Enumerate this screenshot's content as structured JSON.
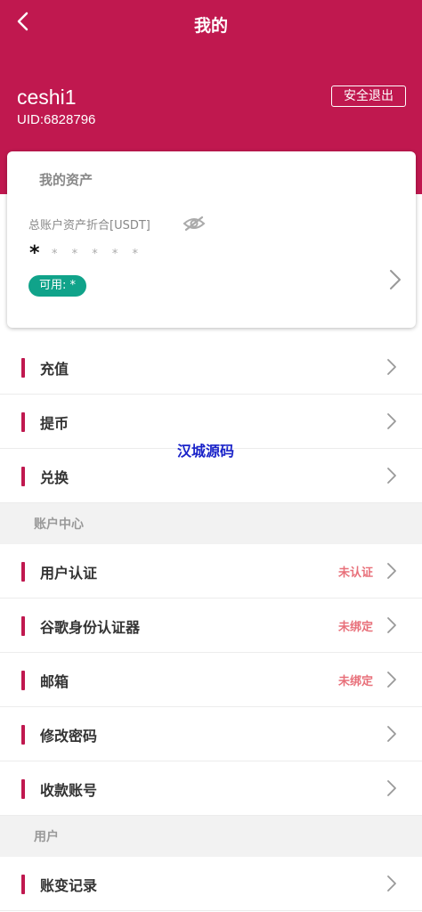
{
  "header": {
    "title": "我的",
    "username": "ceshi1",
    "uid": "UID:6828796",
    "logout_label": "安全退出",
    "accent_color": "#c0184f"
  },
  "assets": {
    "title": "我的资产",
    "total_label": "总账户资产折合[USDT]",
    "masked_main": "*",
    "masked_secondary": "* * * * *",
    "available_label": "可用: *",
    "available_color": "#10a38a"
  },
  "menu": {
    "recharge": "充值",
    "withdraw": "提币",
    "exchange": "兑换",
    "account_center": "账户中心",
    "verification": "用户认证",
    "verification_status": "未认证",
    "google_auth": "谷歌身份认证器",
    "google_auth_status": "未绑定",
    "email": "邮箱",
    "email_status": "未绑定",
    "change_password": "修改密码",
    "payment_account": "收款账号",
    "user_section": "用户",
    "account_records": "账变记录"
  },
  "watermark": "汉城源码"
}
